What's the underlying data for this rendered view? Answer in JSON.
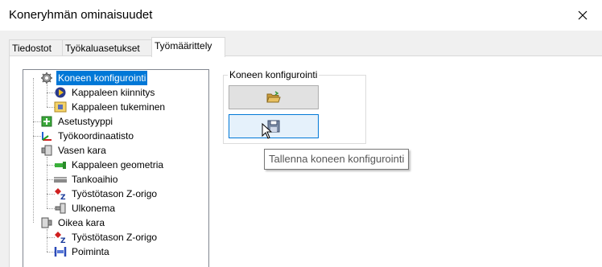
{
  "window": {
    "title": "Koneryhmän ominaisuudet",
    "close_icon": "close-icon"
  },
  "tabs": [
    {
      "label": "Tiedostot",
      "active": false
    },
    {
      "label": "Työkaluasetukset",
      "active": false
    },
    {
      "label": "Työmäärittely",
      "active": true
    }
  ],
  "tree": {
    "items": [
      {
        "label": "Koneen konfigurointi",
        "icon": "gear-icon",
        "selected": true
      },
      {
        "label": "Kappaleen kiinnitys",
        "icon": "fixture-icon"
      },
      {
        "label": "Kappaleen tukeminen",
        "icon": "support-icon"
      },
      {
        "label": "Asetustyyppi",
        "icon": "setup-type-icon"
      },
      {
        "label": "Työkoordinaatisto",
        "icon": "coordinate-system-icon"
      },
      {
        "label": "Vasen kara",
        "icon": "spindle-icon"
      },
      {
        "label": "Kappaleen geometria",
        "icon": "part-geometry-icon"
      },
      {
        "label": "Tankoaihio",
        "icon": "bar-stock-icon"
      },
      {
        "label": "Työstötason Z-origo",
        "icon": "z-origin-icon"
      },
      {
        "label": "Ulkonema",
        "icon": "overhang-icon"
      },
      {
        "label": "Oikea kara",
        "icon": "spindle-icon"
      },
      {
        "label": "Työstötason Z-origo",
        "icon": "z-origin-icon"
      },
      {
        "label": "Poiminta",
        "icon": "pickup-icon"
      }
    ]
  },
  "machine_config": {
    "group_label": "Koneen konfigurointi",
    "open_button_icon": "open-folder-icon",
    "save_button_icon": "save-disk-icon",
    "tooltip": "Tallenna koneen konfigurointi"
  },
  "colors": {
    "selection": "#0078d7",
    "hover_button": "#e5f1fb"
  }
}
